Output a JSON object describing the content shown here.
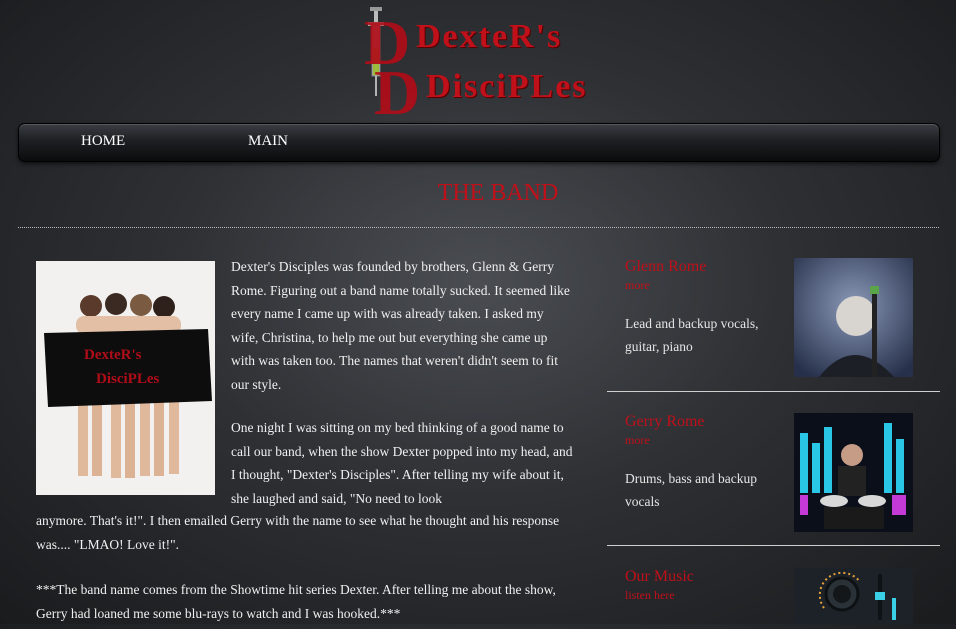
{
  "logo": {
    "line1": "DexteR's",
    "line2": "DisciPLes",
    "color": "#c0101a"
  },
  "nav": {
    "items": [
      {
        "label": "HOME"
      },
      {
        "label": "MAIN"
      }
    ]
  },
  "page": {
    "title": "THE BAND"
  },
  "band_photo": {
    "towel_text_1": "DexteR's",
    "towel_text_2": "DisciPLes"
  },
  "article": {
    "para1": "Dexter's Disciples was founded by brothers, Glenn & Gerry Rome. Figuring out a band name totally sucked. It seemed like every name I came up with was already taken. I asked my wife, Christina, to help me out but everything she came up with was taken too. The names that weren't didn't seem to fit our style.",
    "para2a": "One night I was sitting on my bed thinking of a good name to call our band, when the show Dexter popped into my head, and I thought, \"Dexter's Disciples\". After telling my wife about it, she laughed and said, \"No need to look",
    "para2b": "anymore. That's it!\". I then emailed Gerry with the name to see what he thought and his response was.... \"LMAO! Love it!\".",
    "para3": "***The band name comes from the Showtime hit series Dexter. After telling me about the show, Gerry had loaned me some blu-rays to watch and I was hooked.***"
  },
  "sidebar": {
    "items": [
      {
        "title": "Glenn Rome",
        "more": "more",
        "desc": "Lead and backup vocals, guitar, piano"
      },
      {
        "title": "Gerry Rome",
        "more": "more",
        "desc": "Drums, bass and backup vocals"
      },
      {
        "title": "Our Music",
        "more": "listen here",
        "desc": ""
      }
    ]
  },
  "colors": {
    "accent": "#c0101a",
    "background": "#2e3034",
    "text": "#f0f0f0"
  }
}
